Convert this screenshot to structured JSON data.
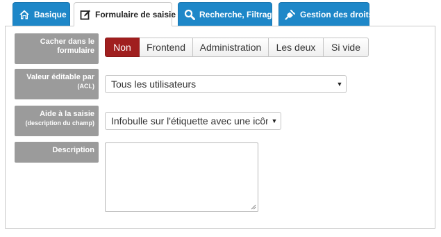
{
  "tabs": [
    {
      "label": "Basique",
      "icon": "home-icon",
      "active": false
    },
    {
      "label": "Formulaire de saisie",
      "icon": "edit-icon",
      "active": true
    },
    {
      "label": "Recherche, Filtrage",
      "icon": "search-icon",
      "active": false
    },
    {
      "label": "Gestion des droits",
      "icon": "plug-icon",
      "active": false
    }
  ],
  "form": {
    "hide": {
      "label": "Cacher dans le formulaire",
      "options": [
        "Non",
        "Frontend",
        "Administration",
        "Les deux",
        "Si vide"
      ],
      "selected": "Non"
    },
    "editable": {
      "label": "Valeur éditable par",
      "sublabel": "(ACL)",
      "value": "Tous les utilisateurs"
    },
    "help": {
      "label": "Aide à la saisie",
      "sublabel": "(description du champ)",
      "value": "Infobulle sur l'étiquette avec une icône"
    },
    "description": {
      "label": "Description",
      "value": ""
    }
  },
  "colors": {
    "tab_blue": "#1e87c8",
    "selected_red": "#a01f1f",
    "label_gray": "#9b9b9b"
  }
}
